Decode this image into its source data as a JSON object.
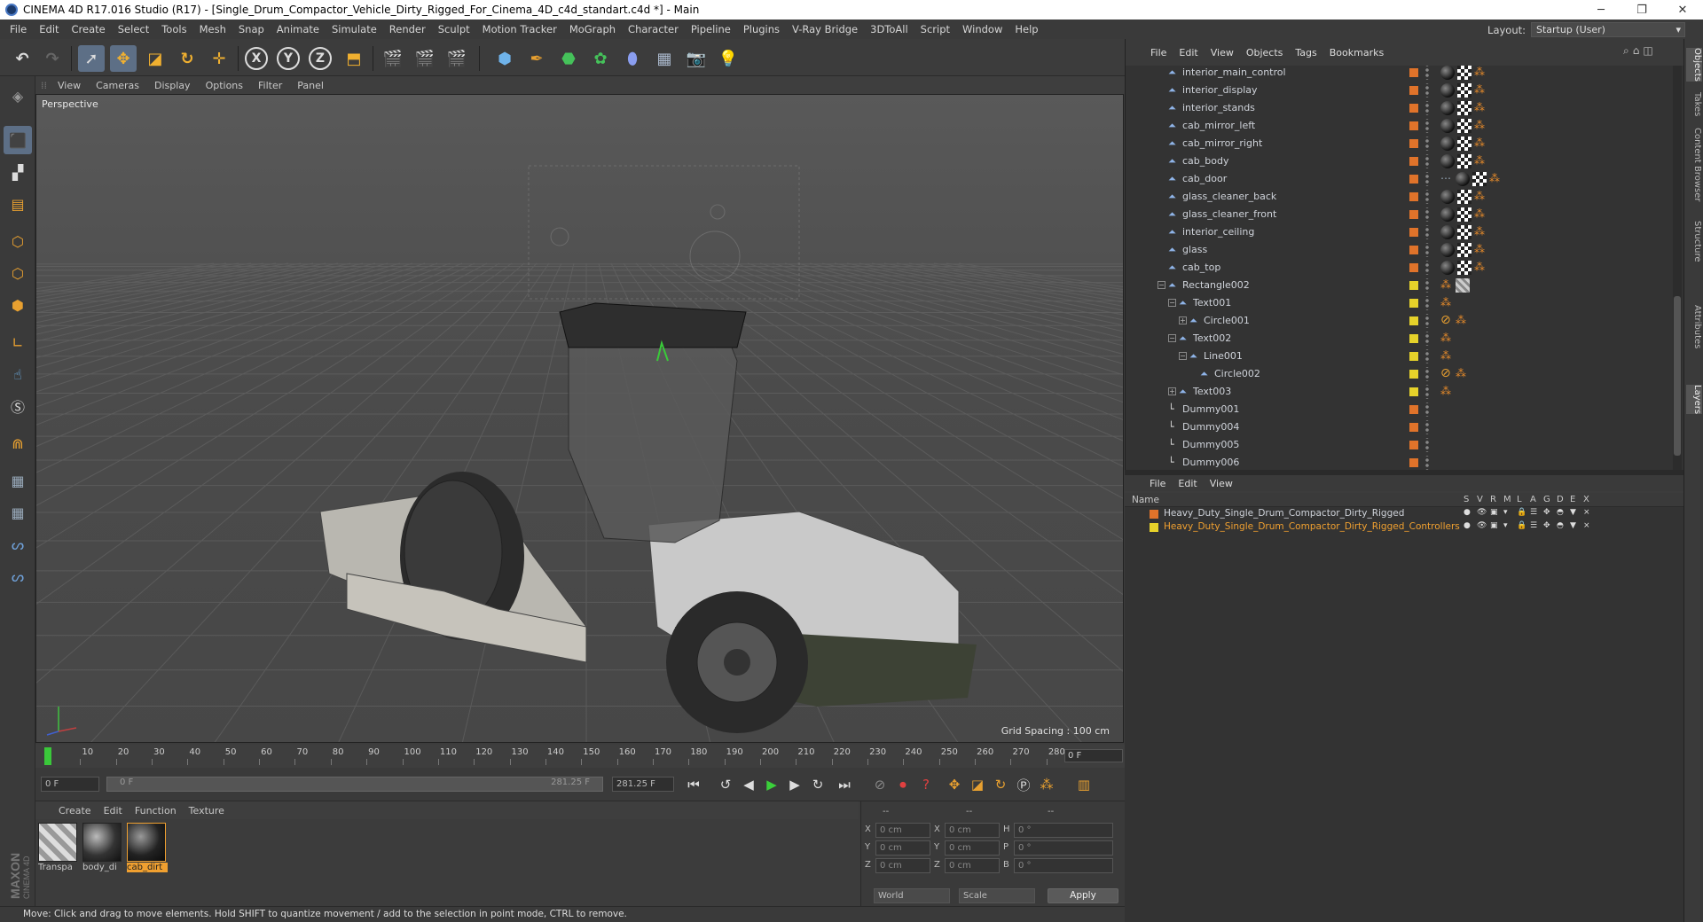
{
  "window": {
    "title": "CINEMA 4D R17.016 Studio (R17) - [Single_Drum_Compactor_Vehicle_Dirty_Rigged_For_Cinema_4D_c4d_standart.c4d *] - Main",
    "controls": [
      "─",
      "❐",
      "✕"
    ]
  },
  "menubar": [
    "File",
    "Edit",
    "Create",
    "Select",
    "Tools",
    "Mesh",
    "Snap",
    "Animate",
    "Simulate",
    "Render",
    "Sculpt",
    "Motion Tracker",
    "MoGraph",
    "Character",
    "Pipeline",
    "Plugins",
    "V-Ray Bridge",
    "3DToAll",
    "Script",
    "Window",
    "Help"
  ],
  "layout": {
    "label": "Layout:",
    "value": "Startup (User)"
  },
  "viewport": {
    "menu": [
      "View",
      "Cameras",
      "Display",
      "Options",
      "Filter",
      "Panel"
    ],
    "label": "Perspective",
    "grid_spacing": "Grid Spacing : 100 cm"
  },
  "timeline": {
    "ticks": [
      "0",
      "10",
      "20",
      "30",
      "40",
      "50",
      "60",
      "70",
      "80",
      "90",
      "100",
      "110",
      "120",
      "130",
      "140",
      "150",
      "160",
      "170",
      "180",
      "190",
      "200",
      "210",
      "220",
      "230",
      "240",
      "250",
      "260",
      "270",
      "280"
    ],
    "current_frame": "0 F",
    "start_field": "0 F",
    "range_start": "0 F",
    "range_end": "281.25 F",
    "end_field": "281.25 F"
  },
  "materials": {
    "menu": [
      "Create",
      "Edit",
      "Function",
      "Texture"
    ],
    "items": [
      {
        "name": "Transpa",
        "selected": false
      },
      {
        "name": "body_di",
        "selected": false
      },
      {
        "name": "cab_dirt",
        "selected": true
      }
    ]
  },
  "coordinates": {
    "headers": [
      "--",
      "--",
      "--"
    ],
    "rows": [
      {
        "a": "X",
        "av": "0 cm",
        "b": "X",
        "bv": "0 cm",
        "c": "H",
        "cv": "0 °"
      },
      {
        "a": "Y",
        "av": "0 cm",
        "b": "Y",
        "bv": "0 cm",
        "c": "P",
        "cv": "0 °"
      },
      {
        "a": "Z",
        "av": "0 cm",
        "b": "Z",
        "bv": "0 cm",
        "c": "B",
        "cv": "0 °"
      }
    ],
    "mode": "World",
    "type": "Scale",
    "apply": "Apply"
  },
  "status": "Move: Click and drag to move elements. Hold SHIFT to quantize movement / add to the selection in point mode, CTRL to remove.",
  "objects": {
    "menu": [
      "File",
      "Edit",
      "View",
      "Objects",
      "Tags",
      "Bookmarks"
    ],
    "rows": [
      {
        "name": "interior_main_control",
        "indent": 0,
        "icon": "polygon",
        "layer": "#e0732a",
        "tags": [
          "ball",
          "chk",
          "or"
        ]
      },
      {
        "name": "interior_display",
        "indent": 0,
        "icon": "polygon",
        "layer": "#e0732a",
        "tags": [
          "ball",
          "chk",
          "or"
        ]
      },
      {
        "name": "interior_stands",
        "indent": 0,
        "icon": "polygon",
        "layer": "#e0732a",
        "tags": [
          "ball",
          "chk",
          "or"
        ]
      },
      {
        "name": "cab_mirror_left",
        "indent": 0,
        "icon": "polygon",
        "layer": "#e0732a",
        "tags": [
          "ball",
          "chk",
          "or"
        ]
      },
      {
        "name": "cab_mirror_right",
        "indent": 0,
        "icon": "polygon",
        "layer": "#e0732a",
        "tags": [
          "ball",
          "chk",
          "or"
        ]
      },
      {
        "name": "cab_body",
        "indent": 0,
        "icon": "polygon",
        "layer": "#e0732a",
        "tags": [
          "ball",
          "chk",
          "or"
        ]
      },
      {
        "name": "cab_door",
        "indent": 0,
        "icon": "polygon",
        "layer": "#e0732a",
        "tags": [
          "dots",
          "ball",
          "chk",
          "or"
        ]
      },
      {
        "name": "glass_cleaner_back",
        "indent": 0,
        "icon": "polygon",
        "layer": "#e0732a",
        "tags": [
          "ball",
          "chk",
          "or"
        ]
      },
      {
        "name": "glass_cleaner_front",
        "indent": 0,
        "icon": "polygon",
        "layer": "#e0732a",
        "tags": [
          "ball",
          "chk",
          "or"
        ]
      },
      {
        "name": "interior_ceiling",
        "indent": 0,
        "icon": "polygon",
        "layer": "#e0732a",
        "tags": [
          "ball",
          "chk",
          "or"
        ]
      },
      {
        "name": "glass",
        "indent": 0,
        "icon": "polygon",
        "layer": "#e0732a",
        "tags": [
          "ball",
          "chk",
          "or"
        ]
      },
      {
        "name": "cab_top",
        "indent": 0,
        "icon": "polygon",
        "layer": "#e0732a",
        "tags": [
          "ball",
          "chk",
          "or"
        ]
      },
      {
        "name": "Rectangle002",
        "indent": 0,
        "icon": "spline",
        "layer": "#e6d22a",
        "tags": [
          "or",
          "hatch"
        ],
        "expander": "−"
      },
      {
        "name": "Text001",
        "indent": 1,
        "icon": "spline",
        "layer": "#e6d22a",
        "tags": [
          "or"
        ],
        "expander": "−"
      },
      {
        "name": "Circle001",
        "indent": 2,
        "icon": "spline",
        "layer": "#e6d22a",
        "tags": [
          "no",
          "or"
        ],
        "expander": "+"
      },
      {
        "name": "Text002",
        "indent": 1,
        "icon": "spline",
        "layer": "#e6d22a",
        "tags": [
          "or"
        ],
        "expander": "−"
      },
      {
        "name": "Line001",
        "indent": 2,
        "icon": "spline",
        "layer": "#e6d22a",
        "tags": [
          "or"
        ],
        "expander": "−"
      },
      {
        "name": "Circle002",
        "indent": 3,
        "icon": "spline",
        "layer": "#e6d22a",
        "tags": [
          "no",
          "or"
        ]
      },
      {
        "name": "Text003",
        "indent": 1,
        "icon": "spline",
        "layer": "#e6d22a",
        "tags": [
          "or"
        ],
        "expander": "+"
      },
      {
        "name": "Dummy001",
        "indent": 0,
        "icon": "null",
        "layer": "#e0732a",
        "tags": []
      },
      {
        "name": "Dummy004",
        "indent": 0,
        "icon": "null",
        "layer": "#e0732a",
        "tags": []
      },
      {
        "name": "Dummy005",
        "indent": 0,
        "icon": "null",
        "layer": "#e0732a",
        "tags": []
      },
      {
        "name": "Dummy006",
        "indent": 0,
        "icon": "null",
        "layer": "#e0732a",
        "tags": []
      }
    ]
  },
  "layers": {
    "menu": [
      "File",
      "Edit",
      "View"
    ],
    "header_name": "Name",
    "columns": [
      "S",
      "V",
      "R",
      "M",
      "L",
      "A",
      "G",
      "D",
      "E",
      "X"
    ],
    "rows": [
      {
        "name": "Heavy_Duty_Single_Drum_Compactor_Dirty_Rigged",
        "color": "#e0732a",
        "text_color": "#cfd3da"
      },
      {
        "name": "Heavy_Duty_Single_Drum_Compactor_Dirty_Rigged_Controllers",
        "color": "#e6d22a",
        "text_color": "#f0a030"
      }
    ]
  },
  "side_tabs": [
    "Objects",
    "Takes",
    "Content Browser",
    "Structure",
    "Attributes",
    "Layers"
  ],
  "maxon_logo": "MAXON CINEMA 4D"
}
